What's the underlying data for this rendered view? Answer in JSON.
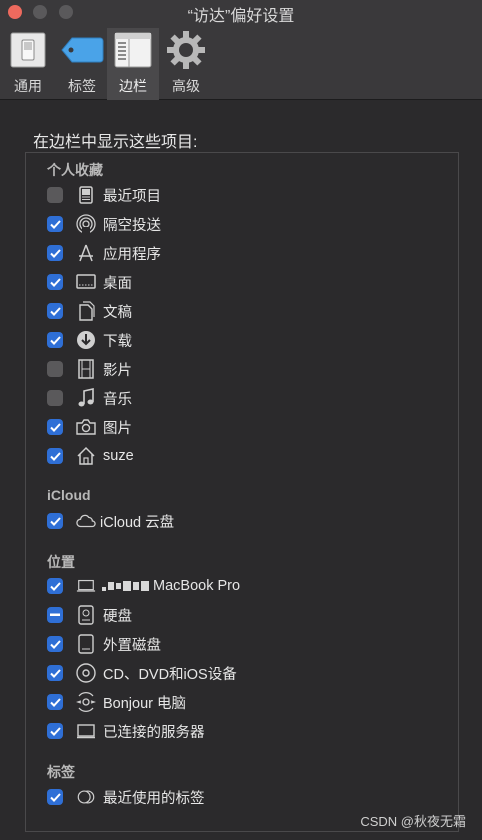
{
  "window": {
    "title": "“访达”偏好设置"
  },
  "toolbar": {
    "general": "通用",
    "tags": "标签",
    "sidebar": "边栏",
    "advanced": "高级"
  },
  "heading": "在边栏中显示这些项目:",
  "sections": {
    "favorites": "个人收藏",
    "icloud": "iCloud",
    "locations": "位置",
    "tags": "标签"
  },
  "items": {
    "recents": {
      "label": "最近项目",
      "checked": false
    },
    "airdrop": {
      "label": "隔空投送",
      "checked": true
    },
    "applications": {
      "label": "应用程序",
      "checked": true
    },
    "desktop": {
      "label": "桌面",
      "checked": true
    },
    "documents": {
      "label": "文稿",
      "checked": true
    },
    "downloads": {
      "label": "下载",
      "checked": true
    },
    "movies": {
      "label": "影片",
      "checked": false
    },
    "music": {
      "label": "音乐",
      "checked": false
    },
    "pictures": {
      "label": "图片",
      "checked": true
    },
    "home": {
      "label": "suze",
      "checked": true
    },
    "icloud_drive": {
      "label": "iCloud 云盘",
      "checked": true
    },
    "macbook": {
      "label": "MacBook Pro",
      "checked": true
    },
    "hard_disks": {
      "label": "硬盘",
      "checked": "mixed"
    },
    "external_disks": {
      "label": "外置磁盘",
      "checked": true
    },
    "cds_dvds": {
      "label": "CD、DVD和iOS设备",
      "checked": true
    },
    "bonjour": {
      "label": "Bonjour 电脑",
      "checked": true
    },
    "servers": {
      "label": "已连接的服务器",
      "checked": true
    },
    "recent_tags": {
      "label": "最近使用的标签",
      "checked": true
    }
  },
  "watermark": "CSDN @秋夜无霜",
  "colors": {
    "accent": "#2f6fd6",
    "close": "#ed6a5e"
  }
}
